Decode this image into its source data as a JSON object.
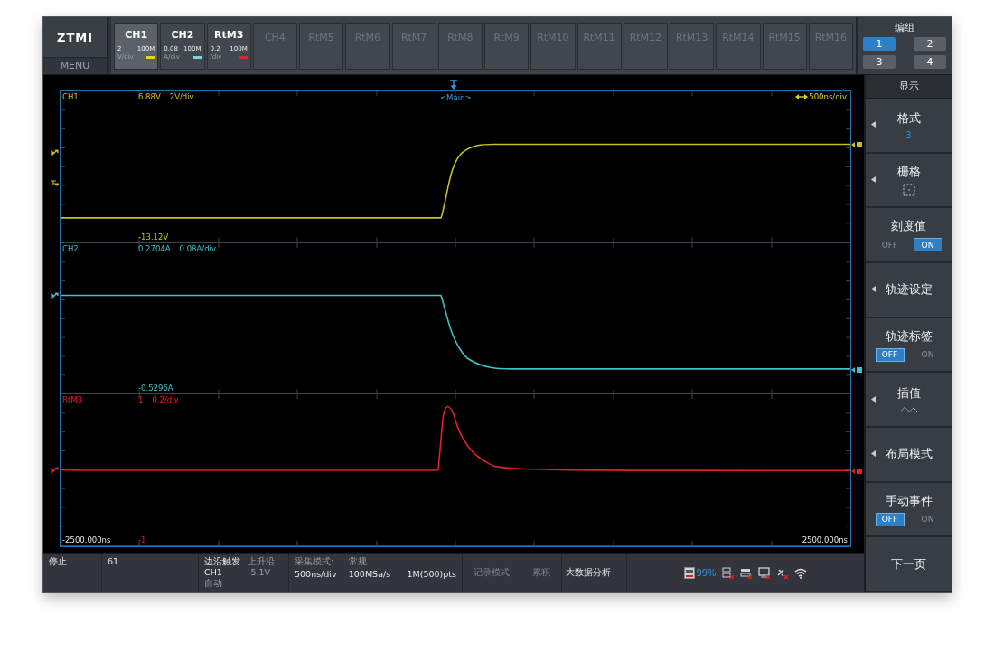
{
  "logo": {
    "brand": "ZTMI",
    "menu": "MENU"
  },
  "channels": [
    {
      "name": "CH1",
      "active": true,
      "selected": true,
      "scale": "2",
      "bandwidth": "100M",
      "unit": "V/div",
      "color": "#e0d22a"
    },
    {
      "name": "CH2",
      "active": true,
      "selected": false,
      "scale": "0.08",
      "bandwidth": "100M",
      "unit": "A/div",
      "color": "#7fd0e0"
    },
    {
      "name": "RtM3",
      "active": true,
      "selected": false,
      "scale": "0.2",
      "bandwidth": "100M",
      "unit": "/div",
      "color": "#d8242a"
    },
    {
      "name": "CH4",
      "active": false,
      "selected": false
    },
    {
      "name": "RtM5",
      "active": false,
      "selected": false
    },
    {
      "name": "RtM6",
      "active": false,
      "selected": false
    },
    {
      "name": "RtM7",
      "active": false,
      "selected": false
    },
    {
      "name": "RtM8",
      "active": false,
      "selected": false
    },
    {
      "name": "RtM9",
      "active": false,
      "selected": false
    },
    {
      "name": "RtM10",
      "active": false,
      "selected": false
    },
    {
      "name": "RtM11",
      "active": false,
      "selected": false
    },
    {
      "name": "RtM12",
      "active": false,
      "selected": false
    },
    {
      "name": "RtM13",
      "active": false,
      "selected": false
    },
    {
      "name": "RtM14",
      "active": false,
      "selected": false
    },
    {
      "name": "RtM15",
      "active": false,
      "selected": false
    },
    {
      "name": "RtM16",
      "active": false,
      "selected": false
    }
  ],
  "group": {
    "title": "编组",
    "buttons": [
      {
        "label": "1",
        "selected": true
      },
      {
        "label": "2",
        "selected": false
      },
      {
        "label": "3",
        "selected": false
      },
      {
        "label": "4",
        "selected": false
      }
    ]
  },
  "display": {
    "timebase_label": "<Main>",
    "timebase": "500ns/div",
    "x_start": "-2500.000ns",
    "x_end": "2500.000ns",
    "panes": [
      {
        "name": "CH1",
        "top_value": "6.88V",
        "scale": "2V/div",
        "bottom_value": "-13.12V",
        "color": "#c8c020",
        "kind": "rise"
      },
      {
        "name": "CH2",
        "top_value": "0.2704A",
        "scale": "0.08A/div",
        "bottom_value": "-0.5296A",
        "color": "#40c0c8",
        "kind": "fall"
      },
      {
        "name": "RtM3",
        "top_value": "1",
        "scale": "0.2/div",
        "bottom_value": "-1",
        "color": "#e0202a",
        "kind": "pulse"
      }
    ]
  },
  "side_menu": {
    "title": "显示",
    "items": [
      {
        "label": "格式",
        "kind": "value",
        "submenu": true,
        "value": "3"
      },
      {
        "label": "栅格",
        "kind": "grid",
        "submenu": true
      },
      {
        "label": "刻度值",
        "kind": "toggle",
        "submenu": false,
        "options": [
          {
            "label": "OFF",
            "selected": false
          },
          {
            "label": "ON",
            "selected": true
          }
        ]
      },
      {
        "label": "轨迹设定",
        "kind": "plain",
        "submenu": true
      },
      {
        "label": "轨迹标签",
        "kind": "toggle",
        "submenu": false,
        "options": [
          {
            "label": "OFF",
            "selected": true
          },
          {
            "label": "ON",
            "selected": false
          }
        ]
      },
      {
        "label": "插值",
        "kind": "interp",
        "submenu": true
      },
      {
        "label": "布局模式",
        "kind": "plain",
        "submenu": true
      },
      {
        "label": "手动事件",
        "kind": "toggle",
        "submenu": false,
        "options": [
          {
            "label": "OFF",
            "selected": true
          },
          {
            "label": "ON",
            "selected": false
          }
        ]
      },
      {
        "label": "下一页",
        "kind": "plain",
        "submenu": false
      }
    ]
  },
  "status_bar": {
    "run_state": "停止",
    "count": "61",
    "trigger": {
      "title": "边沿触发",
      "source": "CH1",
      "mode": "自动",
      "edge": "上升沿",
      "level": "-5.1V"
    },
    "acquisition": {
      "label": "采集模式:",
      "mode": "常规",
      "timebase": "500ns/div",
      "sample_rate": "100MSa/s",
      "memory": "1M(500)pts"
    },
    "buttons": [
      {
        "label": "记录模式",
        "disabled": true
      },
      {
        "label": "累积",
        "disabled": true
      },
      {
        "label": "大数据分析",
        "disabled": false
      }
    ],
    "storage": "99%"
  }
}
